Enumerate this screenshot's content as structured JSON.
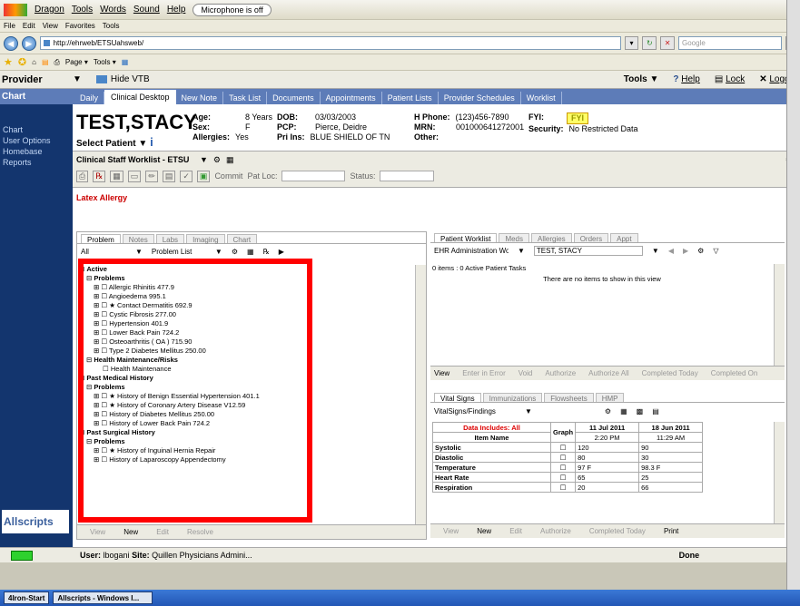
{
  "dragon": {
    "menus": [
      "Dragon",
      "Tools",
      "Words",
      "Sound",
      "Help"
    ],
    "mic_status": "Microphone is off"
  },
  "browser": {
    "menus": [
      "File",
      "Edit",
      "View",
      "Favorites",
      "Tools"
    ],
    "url": "http://ehrweb/ETSUahsweb/",
    "search_placeholder": "Google",
    "fav_items": [
      "Page ▾",
      "Tools ▾"
    ]
  },
  "provider_bar": {
    "label": "Provider",
    "hide": "Hide VTB",
    "tools": "Tools",
    "help": "Help",
    "lock": "Lock",
    "logoff": "Logoff"
  },
  "leftnav": {
    "header": "Chart",
    "items": [
      "Chart",
      "User Options",
      "Homebase",
      "Reports"
    ],
    "logo": "Allscripts"
  },
  "tabs": [
    "Daily",
    "Clinical Desktop",
    "New Note",
    "Task List",
    "Documents",
    "Appointments",
    "Patient Lists",
    "Provider Schedules",
    "Worklist"
  ],
  "patient": {
    "name": "TEST,STACY",
    "select": "Select Patient",
    "age_label": "Age:",
    "age": "8 Years",
    "sex_label": "Sex:",
    "sex": "F",
    "allergies_label": "Allergies:",
    "allergies": "Yes",
    "dob_label": "DOB:",
    "dob": "03/03/2003",
    "pcp_label": "PCP:",
    "pcp": "Pierce, Deidre",
    "ins_label": "Pri Ins:",
    "ins": "BLUE SHIELD OF TN",
    "hphone_label": "H Phone:",
    "hphone": "(123)456-7890",
    "mrn_label": "MRN:",
    "mrn": "001000641272001",
    "other_label": "Other:",
    "fyi_label": "FYI:",
    "fyi_badge": "FYI",
    "security_label": "Security:",
    "security": "No Restricted Data"
  },
  "worklist": {
    "name": "Clinical Staff Worklist - ETSU",
    "commit": "Commit",
    "patloc": "Pat Loc:",
    "status": "Status:"
  },
  "alert": "Latex Allergy",
  "left_pane": {
    "tabs": [
      "Problem",
      "Notes",
      "Labs",
      "Imaging",
      "Chart"
    ],
    "filter": "All",
    "view": "Problem List",
    "tree": [
      {
        "t": "Active",
        "b": true,
        "i": 0,
        "box": "minus",
        "cb": false
      },
      {
        "t": "Problems",
        "b": true,
        "i": 1,
        "box": "minus",
        "cb": false
      },
      {
        "t": "Allergic Rhinitis 477.9",
        "b": false,
        "i": 2,
        "box": "plus",
        "cb": true
      },
      {
        "t": "Angioedema 995.1",
        "b": false,
        "i": 2,
        "box": "plus",
        "cb": true
      },
      {
        "t": "★ Contact Dermatitis 692.9",
        "b": false,
        "i": 2,
        "box": "plus",
        "cb": true
      },
      {
        "t": "Cystic Fibrosis 277.00",
        "b": false,
        "i": 2,
        "box": "plus",
        "cb": true
      },
      {
        "t": "Hypertension 401.9",
        "b": false,
        "i": 2,
        "box": "plus",
        "cb": true
      },
      {
        "t": "Lower Back Pain 724.2",
        "b": false,
        "i": 2,
        "box": "plus",
        "cb": true
      },
      {
        "t": "Osteoarthritis ( OA ) 715.90",
        "b": false,
        "i": 2,
        "box": "plus",
        "cb": true
      },
      {
        "t": "Type 2 Diabetes Mellitus 250.00",
        "b": false,
        "i": 2,
        "box": "plus",
        "cb": true
      },
      {
        "t": "Health Maintenance/Risks",
        "b": true,
        "i": 1,
        "box": "minus",
        "cb": false
      },
      {
        "t": "Health Maintenance",
        "b": false,
        "i": 2,
        "box": "none",
        "cb": true
      },
      {
        "t": "Past Medical History",
        "b": true,
        "i": 0,
        "box": "minus",
        "cb": false
      },
      {
        "t": "Problems",
        "b": true,
        "i": 1,
        "box": "minus",
        "cb": false
      },
      {
        "t": "★ History of Benign Essential Hypertension 401.1",
        "b": false,
        "i": 2,
        "box": "plus",
        "cb": true
      },
      {
        "t": "★ History of Coronary Artery Disease V12.59",
        "b": false,
        "i": 2,
        "box": "plus",
        "cb": true
      },
      {
        "t": "History of Diabetes Mellitus 250.00",
        "b": false,
        "i": 2,
        "box": "plus",
        "cb": true
      },
      {
        "t": "History of Lower Back Pain 724.2",
        "b": false,
        "i": 2,
        "box": "plus",
        "cb": true
      },
      {
        "t": "Past Surgical History",
        "b": true,
        "i": 0,
        "box": "minus",
        "cb": false
      },
      {
        "t": "Problems",
        "b": true,
        "i": 1,
        "box": "minus",
        "cb": false
      },
      {
        "t": "★ History of Inguinal Hernia Repair",
        "b": false,
        "i": 2,
        "box": "plus",
        "cb": true
      },
      {
        "t": "History of Laparoscopy Appendectomy",
        "b": false,
        "i": 2,
        "box": "plus",
        "cb": true
      }
    ],
    "footer": [
      "View",
      "New",
      "Edit",
      "Resolve"
    ]
  },
  "right_top": {
    "tabs": [
      "Patient Worklist",
      "Meds",
      "Allergies",
      "Orders",
      "Appt"
    ],
    "filter": "EHR Administration Workl",
    "patient": "TEST, STACY",
    "count": "0 items : 0 Active Patient Tasks",
    "empty": "There are no items to show in this view",
    "actions": [
      "View",
      "Enter in Error",
      "Void",
      "Authorize",
      "Authorize All",
      "Completed Today",
      "Completed On"
    ]
  },
  "right_bottom": {
    "tabs": [
      "Vital Signs",
      "Immunizations",
      "Flowsheets",
      "HMP"
    ],
    "filter": "VitalSigns/Findings",
    "data_includes": "Data Includes: All",
    "graph": "Graph",
    "item_name": "Item Name",
    "col1_date": "11 Jul 2011",
    "col1_time": "2:20 PM",
    "col2_date": "18 Jun 2011",
    "col2_time": "11:29 AM",
    "rows": [
      {
        "name": "Systolic",
        "v1": "120",
        "v2": "90"
      },
      {
        "name": "Diastolic",
        "v1": "80",
        "v2": "30"
      },
      {
        "name": "Temperature",
        "v1": "97 F",
        "v2": "98.3 F"
      },
      {
        "name": "Heart Rate",
        "v1": "65",
        "v2": "25"
      },
      {
        "name": "Respiration",
        "v1": "20",
        "v2": "66"
      }
    ],
    "footer": [
      "View",
      "New",
      "Edit",
      "Authorize",
      "Completed Today",
      "Print"
    ]
  },
  "status": {
    "user_label": "User:",
    "user": "lbogani",
    "site_label": "Site:",
    "site": "Quillen Physicians Admini...",
    "done": "Done"
  },
  "taskbar": {
    "items": [
      "4Iron-Start",
      "Allscripts - Windows I..."
    ]
  }
}
